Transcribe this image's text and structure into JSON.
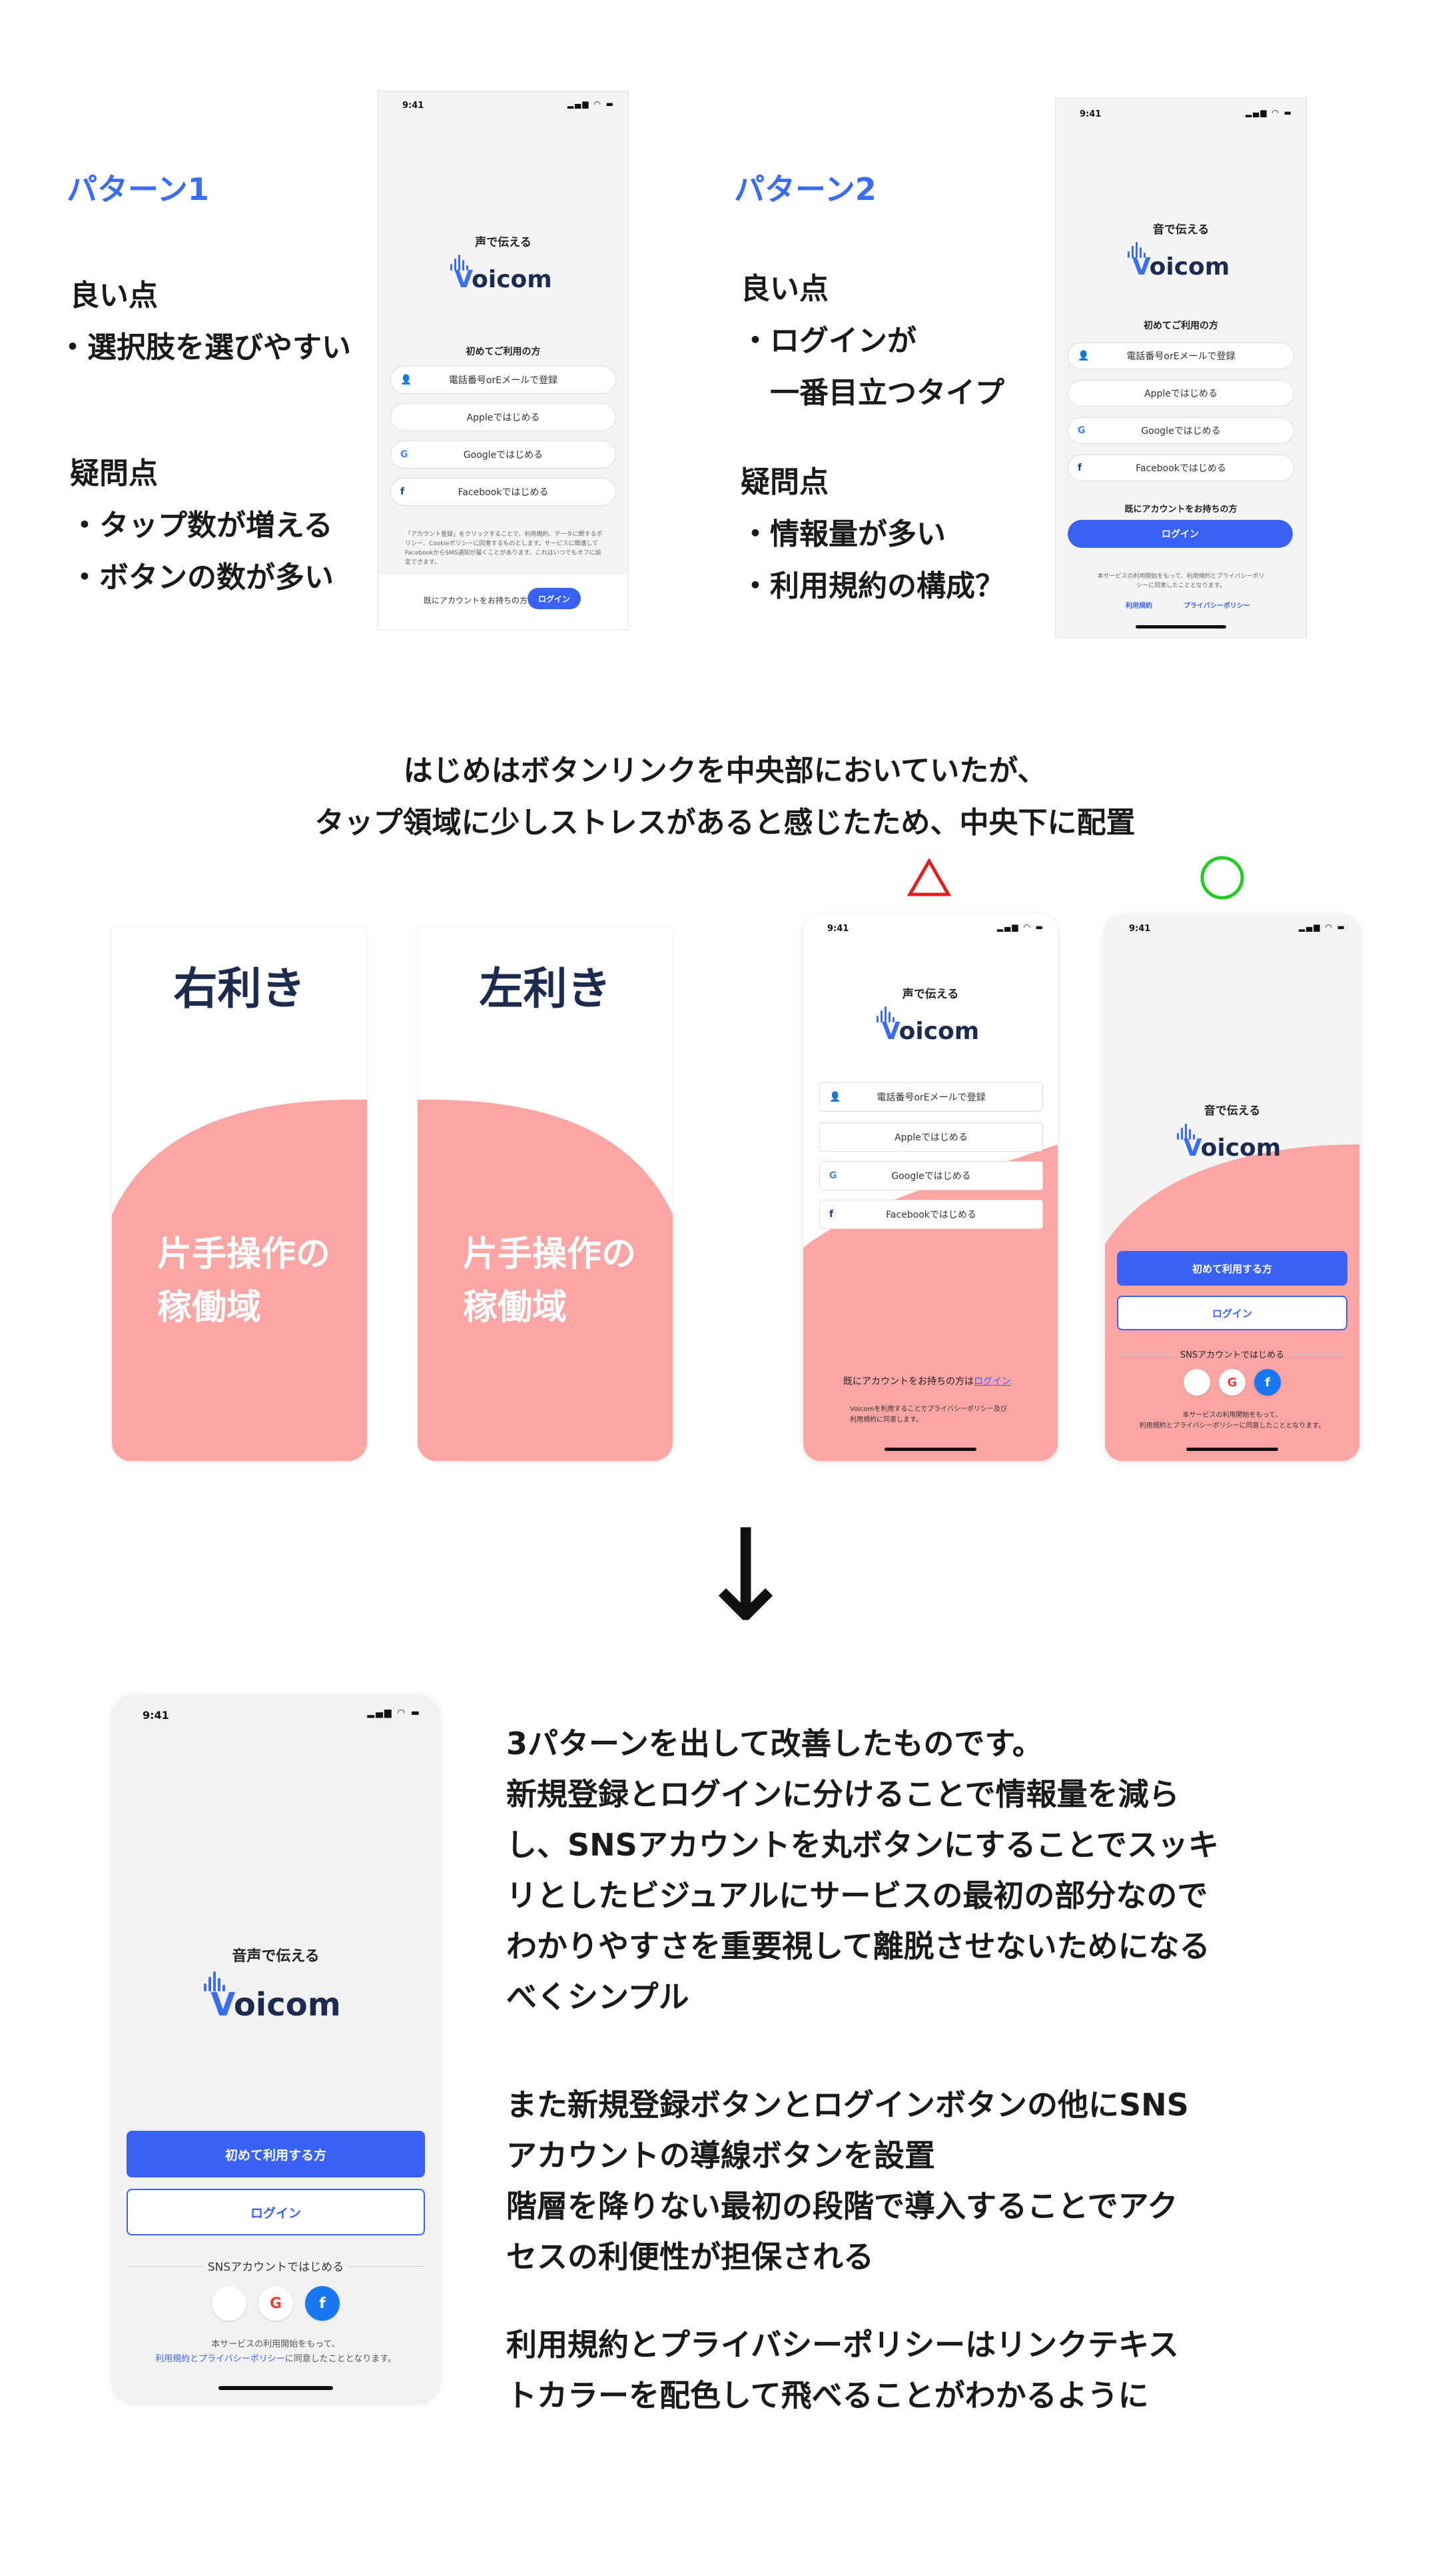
{
  "pattern1": {
    "title": "パターン1",
    "good_heading": "良い点",
    "good_items": [
      "・選択肢を選びやすい"
    ],
    "question_heading": "疑問点",
    "question_items": [
      "・タップ数が増える",
      "・ボタンの数が多い"
    ],
    "phone": {
      "time": "9:41",
      "tagline": "声で伝える",
      "logo_v": "V",
      "logo_rest": "oicom",
      "first_time": "初めてご利用の方",
      "buttons": [
        "電話番号orEメールで登録",
        "Appleではじめる",
        "Googleではじめる",
        "Facebookではじめる"
      ],
      "fine_print": "「アカウント登録」をクリックすることで、利用規約、データに関するポリシー、Cookieポリシーに同意するものとします。サービスに関連してFacebookからSMS通知が届くことがあります。これはいつでもオフに設定できます。",
      "existing_account": "既にアカウントをお持ちの方は",
      "login": "ログイン"
    }
  },
  "pattern2": {
    "title": "パターン2",
    "good_heading": "良い点",
    "good_items": [
      "・ログインが",
      "　一番目立つタイプ"
    ],
    "question_heading": "疑問点",
    "question_items": [
      "・情報量が多い",
      "・利用規約の構成？"
    ],
    "phone": {
      "time": "9:41",
      "tagline": "音で伝える",
      "logo_v": "V",
      "logo_rest": "oicom",
      "first_time": "初めてご利用の方",
      "buttons": [
        "電話番号orEメールで登録",
        "Appleではじめる",
        "Googleではじめる",
        "Facebookではじめる"
      ],
      "existing_account": "既にアカウントをお持ちの方",
      "login": "ログイン",
      "fine_print": "本サービスの利用開始をもって、利用規約とプライバシーポリシーに同意したこととなります。",
      "terms": "利用規約",
      "privacy": "プライバシーポリシー"
    }
  },
  "middle_caption": [
    "はじめはボタンリンクを中央部においていたが、",
    "タップ領域に少しストレスがあると感じたため、中央下に配置"
  ],
  "marks": {
    "triangle": "△",
    "circle": "○"
  },
  "zones": [
    {
      "title": "右利き",
      "text": [
        "片手操作の",
        "稼働域"
      ]
    },
    {
      "title": "左利き",
      "text": [
        "片手操作の",
        "稼働域"
      ]
    }
  ],
  "phone_a": {
    "time": "9:41",
    "tagline": "声で伝える",
    "logo_v": "V",
    "logo_rest": "oicom",
    "buttons": [
      "電話番号orEメールで登録",
      "Appleではじめる",
      "Googleではじめる",
      "Facebookではじめる"
    ],
    "existing_account": "既にアカウントをお持ちの方は",
    "login": "ログイン",
    "fine_print_1": "Voicomを利用することでプライバシーポリシー及び",
    "fine_print_2": "利用規約に同意します。"
  },
  "phone_b": {
    "time": "9:41",
    "tagline": "音で伝える",
    "logo_v": "V",
    "logo_rest": "oicom",
    "first_button": "初めて利用する方",
    "login_button": "ログイン",
    "sns_label": "SNSアカウントではじめる",
    "fine_print_1": "本サービスの利用開始をもって、",
    "fine_print_2": "利用規約とプライバシーポリシーに同意したこととなります。"
  },
  "arrow": "↓",
  "final_phone": {
    "time": "9:41",
    "tagline": "音声で伝える",
    "logo_v": "V",
    "logo_rest": "oicom",
    "first_button": "初めて利用する方",
    "login_button": "ログイン",
    "sns_label": "SNSアカウントではじめる",
    "fine_print_1": "本サービスの利用開始をもって、",
    "fine_print_2_link": "利用規約とプライバシーポリシー",
    "fine_print_2_rest": "に同意したこととなります。"
  },
  "description": {
    "para1": [
      "3パターンを出して改善したものです。",
      "新規登録とログインに分けることで情報量を減ら",
      "し、SNSアカウントを丸ボタンにすることでスッキ",
      "リとしたビジュアルにサービスの最初の部分なので",
      "わかりやすさを重要視して離脱させないためになる",
      "べくシンプル"
    ],
    "para2": [
      "また新規登録ボタンとログインボタンの他にSNS",
      "アカウントの導線ボタンを設置",
      "階層を降りない最初の段階で導入することでアク",
      "セスの利便性が担保される"
    ],
    "para3": [
      "利用規約とプライバシーポリシーはリンクテキス",
      "トカラーを配色して飛べることがわかるように"
    ]
  },
  "icons": {
    "person": "person-icon",
    "apple": "apple-icon",
    "google": "google-icon",
    "facebook": "facebook-icon",
    "signal": "signal-icon",
    "wifi": "wifi-icon",
    "battery": "battery-icon"
  },
  "colors": {
    "accent": "#3b6cf6",
    "zone_pink": "#fba5a4",
    "triangle": "#e02020",
    "circle": "#22cc22"
  }
}
